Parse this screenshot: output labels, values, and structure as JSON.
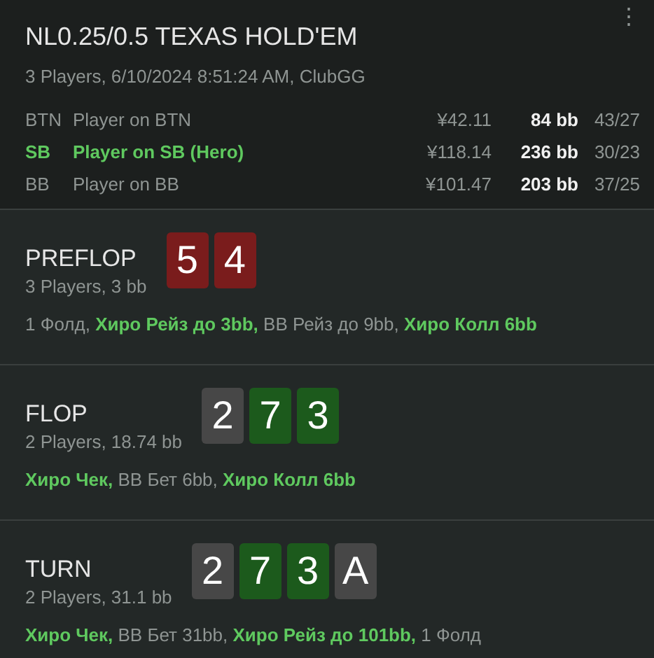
{
  "header": {
    "title": "NL0.25/0.5 TEXAS HOLD'EM",
    "subtitle": "3 Players, 6/10/2024 8:51:24 AM, ClubGG",
    "menu_icon": "⋮"
  },
  "players": [
    {
      "position": "BTN",
      "name": "Player on BTN",
      "money": "¥42.11",
      "stack": "84 bb",
      "stats": "43/27",
      "hero": false
    },
    {
      "position": "SB",
      "name": "Player on SB (Hero)",
      "money": "¥118.14",
      "stack": "236 bb",
      "stats": "30/23",
      "hero": true
    },
    {
      "position": "BB",
      "name": "Player on BB",
      "money": "¥101.47",
      "stack": "203 bb",
      "stats": "37/25",
      "hero": false
    }
  ],
  "streets": [
    {
      "name": "PREFLOP",
      "info": "3 Players, 3 bb",
      "cards": [
        {
          "rank": "5",
          "color": "#7a1c1c"
        },
        {
          "rank": "4",
          "color": "#7a1c1c"
        }
      ],
      "actions": "1 Фолд, **Хиро Рейз до 3bb,** BB Рейз до 9bb, **Хиро Колл 6bb**"
    },
    {
      "name": "FLOP",
      "info": "2 Players, 18.74 bb",
      "cards": [
        {
          "rank": "2",
          "color": "#474747"
        },
        {
          "rank": "7",
          "color": "#1c5a1c"
        },
        {
          "rank": "3",
          "color": "#1c5a1c"
        }
      ],
      "actions": "**Хиро Чек,** BB Бет 6bb, **Хиро Колл 6bb**"
    },
    {
      "name": "TURN",
      "info": "2 Players, 31.1 bb",
      "cards": [
        {
          "rank": "2",
          "color": "#474747"
        },
        {
          "rank": "7",
          "color": "#1c5a1c"
        },
        {
          "rank": "3",
          "color": "#1c5a1c"
        },
        {
          "rank": "A",
          "color": "#474747"
        }
      ],
      "actions": "**Хиро Чек,** BB Бет 31bb, **Хиро Рейз до 101bb,** 1 Фолд"
    }
  ]
}
